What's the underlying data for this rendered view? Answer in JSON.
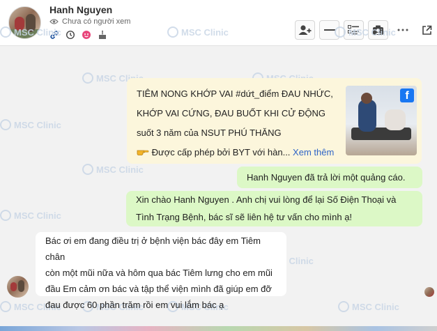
{
  "contact": {
    "name": "Hanh Nguyen",
    "viewer_status": "Chưa có người xem"
  },
  "header_icons": [
    "link-icon",
    "history-icon",
    "emoji-icon",
    "birthday-cake-icon"
  ],
  "toolbar": [
    "add-contact-icon",
    "minus-icon",
    "list-details-icon",
    "profile-card-icon",
    "more-icon",
    "open-external-icon"
  ],
  "watermark": "MSC Clinic",
  "ad": {
    "line1": "TIÊM NONG KHỚP VAI #dứt_điểm ĐAU NHỨC,",
    "line2": "KHỚP VAI CỨNG, ĐAU BUỐT KHI CỬ ĐỘNG",
    "line3": "suốt 3 năm của NSUT PHÚ THĂNG",
    "line4": "Được cấp phép bởi BYT với hàn...",
    "more_label": "Xem thêm",
    "thumb_badge": "f"
  },
  "messages": {
    "reply_notice": "Hanh Nguyen đã trả lời một quảng cáo.",
    "greeting": [
      "Xin chào Hanh Nguyen . Anh chị vui lòng để lại Số Điện Thoại và",
      "Tình Trạng Bệnh, bác sĩ sẽ liên hệ tư vấn cho mình ạ!"
    ],
    "customer": [
      "Bác ơi em đang điều trị ở bệnh viện bác đây em Tiêm chân",
      "còn một mũi nữa và hôm qua bác Tiêm lưng cho em mũi",
      "đầu Em cảm ơn bác và tập thể viện mình đã giúp em đỡ",
      "đau được 60 phần trăm rồi em vui lắm bác ạ"
    ]
  }
}
